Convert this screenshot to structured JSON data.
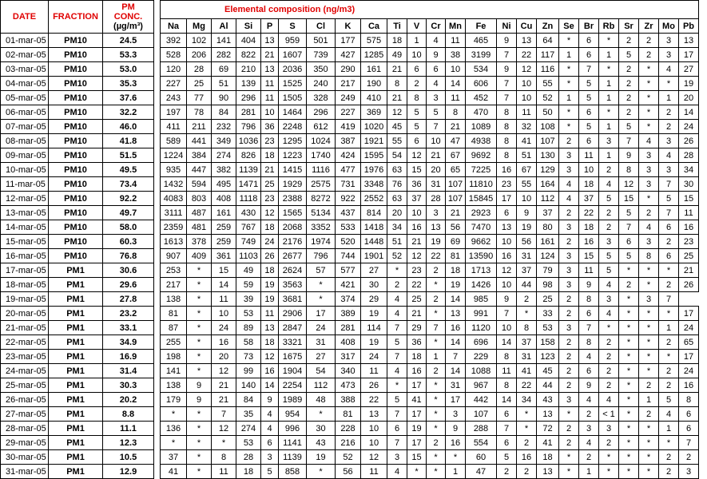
{
  "headers": {
    "date": "DATE",
    "fraction": "FRACTION",
    "pm_line1": "PM",
    "pm_line2": "CONC.",
    "pm_unit": "(µg/m³)",
    "group": "Elemental composition (ng/m3)"
  },
  "elements": [
    "Na",
    "Mg",
    "Al",
    "Si",
    "P",
    "S",
    "Cl",
    "K",
    "Ca",
    "Ti",
    "V",
    "Cr",
    "Mn",
    "Fe",
    "Ni",
    "Cu",
    "Zn",
    "Se",
    "Br",
    "Rb",
    "Sr",
    "Zr",
    "Mo",
    "Pb"
  ],
  "rows": [
    [
      "01-mar-05",
      "PM10",
      "24.5",
      [
        "392",
        "102",
        "141",
        "404",
        "13",
        "959",
        "501",
        "177",
        "575",
        "18",
        "1",
        "4",
        "11",
        "465",
        "9",
        "13",
        "64",
        "*",
        "6",
        "*",
        "2",
        "2",
        "3",
        "13"
      ]
    ],
    [
      "02-mar-05",
      "PM10",
      "53.3",
      [
        "528",
        "206",
        "282",
        "822",
        "21",
        "1607",
        "739",
        "427",
        "1285",
        "49",
        "10",
        "9",
        "38",
        "3199",
        "7",
        "22",
        "117",
        "1",
        "6",
        "1",
        "5",
        "2",
        "3",
        "17"
      ]
    ],
    [
      "03-mar-05",
      "PM10",
      "53.0",
      [
        "120",
        "28",
        "69",
        "210",
        "13",
        "2036",
        "350",
        "290",
        "161",
        "21",
        "6",
        "6",
        "10",
        "534",
        "9",
        "12",
        "116",
        "*",
        "7",
        "*",
        "2",
        "*",
        "4",
        "27"
      ]
    ],
    [
      "04-mar-05",
      "PM10",
      "35.3",
      [
        "227",
        "25",
        "51",
        "139",
        "11",
        "1525",
        "240",
        "217",
        "190",
        "8",
        "2",
        "4",
        "14",
        "606",
        "7",
        "10",
        "55",
        "*",
        "5",
        "1",
        "2",
        "*",
        "*",
        "19"
      ]
    ],
    [
      "05-mar-05",
      "PM10",
      "37.6",
      [
        "243",
        "77",
        "90",
        "296",
        "11",
        "1505",
        "328",
        "249",
        "410",
        "21",
        "8",
        "3",
        "11",
        "452",
        "7",
        "10",
        "52",
        "1",
        "5",
        "1",
        "2",
        "*",
        "1",
        "20"
      ]
    ],
    [
      "06-mar-05",
      "PM10",
      "32.2",
      [
        "197",
        "78",
        "84",
        "281",
        "10",
        "1464",
        "296",
        "227",
        "369",
        "12",
        "5",
        "5",
        "8",
        "470",
        "8",
        "11",
        "50",
        "*",
        "6",
        "*",
        "2",
        "*",
        "2",
        "14"
      ]
    ],
    [
      "07-mar-05",
      "PM10",
      "46.0",
      [
        "411",
        "211",
        "232",
        "796",
        "36",
        "2248",
        "612",
        "419",
        "1020",
        "45",
        "5",
        "7",
        "21",
        "1089",
        "8",
        "32",
        "108",
        "*",
        "5",
        "1",
        "5",
        "*",
        "2",
        "24"
      ]
    ],
    [
      "08-mar-05",
      "PM10",
      "41.8",
      [
        "589",
        "441",
        "349",
        "1036",
        "23",
        "1295",
        "1024",
        "387",
        "1921",
        "55",
        "6",
        "10",
        "47",
        "4938",
        "8",
        "41",
        "107",
        "2",
        "6",
        "3",
        "7",
        "4",
        "3",
        "26"
      ]
    ],
    [
      "09-mar-05",
      "PM10",
      "51.5",
      [
        "1224",
        "384",
        "274",
        "826",
        "18",
        "1223",
        "1740",
        "424",
        "1595",
        "54",
        "12",
        "21",
        "67",
        "9692",
        "8",
        "51",
        "130",
        "3",
        "11",
        "1",
        "9",
        "3",
        "4",
        "28"
      ]
    ],
    [
      "10-mar-05",
      "PM10",
      "49.5",
      [
        "935",
        "447",
        "382",
        "1139",
        "21",
        "1415",
        "1116",
        "477",
        "1976",
        "63",
        "15",
        "20",
        "65",
        "7225",
        "16",
        "67",
        "129",
        "3",
        "10",
        "2",
        "8",
        "3",
        "3",
        "34"
      ]
    ],
    [
      "11-mar-05",
      "PM10",
      "73.4",
      [
        "1432",
        "594",
        "495",
        "1471",
        "25",
        "1929",
        "2575",
        "731",
        "3348",
        "76",
        "36",
        "31",
        "107",
        "11810",
        "23",
        "55",
        "164",
        "4",
        "18",
        "4",
        "12",
        "3",
        "7",
        "30"
      ]
    ],
    [
      "12-mar-05",
      "PM10",
      "92.2",
      [
        "4083",
        "803",
        "408",
        "1118",
        "23",
        "2388",
        "8272",
        "922",
        "2552",
        "63",
        "37",
        "28",
        "107",
        "15845",
        "17",
        "10",
        "112",
        "4",
        "37",
        "5",
        "15",
        "*",
        "5",
        "15"
      ]
    ],
    [
      "13-mar-05",
      "PM10",
      "49.7",
      [
        "3111",
        "487",
        "161",
        "430",
        "12",
        "1565",
        "5134",
        "437",
        "814",
        "20",
        "10",
        "3",
        "21",
        "2923",
        "6",
        "9",
        "37",
        "2",
        "22",
        "2",
        "5",
        "2",
        "7",
        "11"
      ]
    ],
    [
      "14-mar-05",
      "PM10",
      "58.0",
      [
        "2359",
        "481",
        "259",
        "767",
        "18",
        "2068",
        "3352",
        "533",
        "1418",
        "34",
        "16",
        "13",
        "56",
        "7470",
        "13",
        "19",
        "80",
        "3",
        "18",
        "2",
        "7",
        "4",
        "6",
        "16"
      ]
    ],
    [
      "15-mar-05",
      "PM10",
      "60.3",
      [
        "1613",
        "378",
        "259",
        "749",
        "24",
        "2176",
        "1974",
        "520",
        "1448",
        "51",
        "21",
        "19",
        "69",
        "9662",
        "10",
        "56",
        "161",
        "2",
        "16",
        "3",
        "6",
        "3",
        "2",
        "23"
      ]
    ],
    [
      "16-mar-05",
      "PM10",
      "76.8",
      [
        "907",
        "409",
        "361",
        "1103",
        "26",
        "2677",
        "796",
        "744",
        "1901",
        "52",
        "12",
        "22",
        "81",
        "13590",
        "16",
        "31",
        "124",
        "3",
        "15",
        "5",
        "5",
        "8",
        "6",
        "25"
      ]
    ],
    [
      "17-mar-05",
      "PM1",
      "30.6",
      [
        "253",
        "*",
        "15",
        "49",
        "18",
        "2624",
        "57",
        "577",
        "27",
        "*",
        "23",
        "2",
        "18",
        "1713",
        "12",
        "37",
        "79",
        "3",
        "11",
        "5",
        "*",
        "*",
        "*",
        "21"
      ]
    ],
    [
      "18-mar-05",
      "PM1",
      "29.6",
      [
        "217",
        "*",
        "14",
        "59",
        "19",
        "3563",
        "*",
        "421",
        "30",
        "2",
        "22",
        "*",
        "19",
        "1426",
        "10",
        "44",
        "98",
        "3",
        "9",
        "4",
        "2",
        "*",
        "2",
        "26"
      ]
    ],
    [
      "19-mar-05",
      "PM1",
      "27.8",
      [
        "138",
        "*",
        "11",
        "39",
        "19",
        "3681",
        "*",
        "374",
        "29",
        "4",
        "25",
        "2",
        "14",
        "985",
        "9",
        "2",
        "25",
        "2",
        "8",
        "3",
        "*",
        "3",
        "7"
      ]
    ],
    [
      "20-mar-05",
      "PM1",
      "23.2",
      [
        "81",
        "*",
        "10",
        "53",
        "11",
        "2906",
        "17",
        "389",
        "19",
        "4",
        "21",
        "*",
        "13",
        "991",
        "7",
        "*",
        "33",
        "2",
        "6",
        "4",
        "*",
        "*",
        "*",
        "17"
      ]
    ],
    [
      "21-mar-05",
      "PM1",
      "33.1",
      [
        "87",
        "*",
        "24",
        "89",
        "13",
        "2847",
        "24",
        "281",
        "114",
        "7",
        "29",
        "7",
        "16",
        "1120",
        "10",
        "8",
        "53",
        "3",
        "7",
        "*",
        "*",
        "*",
        "1",
        "24"
      ]
    ],
    [
      "22-mar-05",
      "PM1",
      "34.9",
      [
        "255",
        "*",
        "16",
        "58",
        "18",
        "3321",
        "31",
        "408",
        "19",
        "5",
        "36",
        "*",
        "14",
        "696",
        "14",
        "37",
        "158",
        "2",
        "8",
        "2",
        "*",
        "*",
        "2",
        "65"
      ]
    ],
    [
      "23-mar-05",
      "PM1",
      "16.9",
      [
        "198",
        "*",
        "20",
        "73",
        "12",
        "1675",
        "27",
        "317",
        "24",
        "7",
        "18",
        "1",
        "7",
        "229",
        "8",
        "31",
        "123",
        "2",
        "4",
        "2",
        "*",
        "*",
        "*",
        "17"
      ]
    ],
    [
      "24-mar-05",
      "PM1",
      "31.4",
      [
        "141",
        "*",
        "12",
        "99",
        "16",
        "1904",
        "54",
        "340",
        "11",
        "4",
        "16",
        "2",
        "14",
        "1088",
        "11",
        "41",
        "45",
        "2",
        "6",
        "2",
        "*",
        "*",
        "2",
        "24"
      ]
    ],
    [
      "25-mar-05",
      "PM1",
      "30.3",
      [
        "138",
        "9",
        "21",
        "140",
        "14",
        "2254",
        "112",
        "473",
        "26",
        "*",
        "17",
        "*",
        "31",
        "967",
        "8",
        "22",
        "44",
        "2",
        "9",
        "2",
        "*",
        "2",
        "2",
        "16"
      ]
    ],
    [
      "26-mar-05",
      "PM1",
      "20.2",
      [
        "179",
        "9",
        "21",
        "84",
        "9",
        "1989",
        "48",
        "388",
        "22",
        "5",
        "41",
        "*",
        "17",
        "442",
        "14",
        "34",
        "43",
        "3",
        "4",
        "4",
        "*",
        "1",
        "5",
        "8"
      ]
    ],
    [
      "27-mar-05",
      "PM1",
      "8.8",
      [
        "*",
        "*",
        "7",
        "35",
        "4",
        "954",
        "*",
        "81",
        "13",
        "7",
        "17",
        "*",
        "3",
        "107",
        "6",
        "*",
        "13",
        "*",
        "2",
        "< 1",
        "*",
        "2",
        "4",
        "6"
      ]
    ],
    [
      "28-mar-05",
      "PM1",
      "11.1",
      [
        "136",
        "*",
        "12",
        "274",
        "4",
        "996",
        "30",
        "228",
        "10",
        "6",
        "19",
        "*",
        "9",
        "288",
        "7",
        "*",
        "72",
        "2",
        "3",
        "3",
        "*",
        "*",
        "1",
        "6"
      ]
    ],
    [
      "29-mar-05",
      "PM1",
      "12.3",
      [
        "*",
        "*",
        "*",
        "53",
        "6",
        "1141",
        "43",
        "216",
        "10",
        "7",
        "17",
        "2",
        "16",
        "554",
        "6",
        "2",
        "41",
        "2",
        "4",
        "2",
        "*",
        "*",
        "*",
        "7"
      ]
    ],
    [
      "30-mar-05",
      "PM1",
      "10.5",
      [
        "37",
        "*",
        "8",
        "28",
        "3",
        "1139",
        "19",
        "52",
        "12",
        "3",
        "15",
        "*",
        "*",
        "60",
        "5",
        "16",
        "18",
        "*",
        "2",
        "*",
        "*",
        "*",
        "2",
        "2"
      ]
    ],
    [
      "31-mar-05",
      "PM1",
      "12.9",
      [
        "41",
        "*",
        "11",
        "18",
        "5",
        "858",
        "*",
        "56",
        "11",
        "4",
        "*",
        "*",
        "1",
        "47",
        "2",
        "2",
        "13",
        "*",
        "1",
        "*",
        "*",
        "*",
        "2",
        "3"
      ]
    ]
  ]
}
